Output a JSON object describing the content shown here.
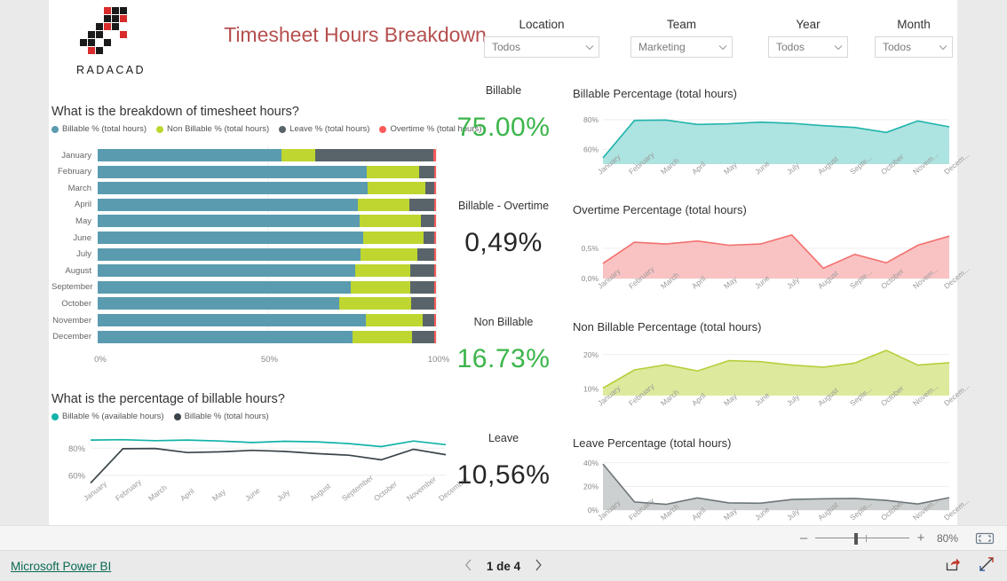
{
  "report": {
    "title": "Timesheet Hours Breakdown",
    "logo_text": "RADACAD"
  },
  "slicers": [
    {
      "name": "location",
      "label": "Location",
      "value": "Todos",
      "icon": "chevron-down-icon"
    },
    {
      "name": "team",
      "label": "Team",
      "value": "Marketing",
      "icon": "chevron-down-icon"
    },
    {
      "name": "year",
      "label": "Year",
      "value": "Todos",
      "icon": "chevron-down-icon"
    },
    {
      "name": "month",
      "label": "Month",
      "value": "Todos",
      "icon": "chevron-down-icon"
    }
  ],
  "kpis": [
    {
      "name": "billable",
      "label": "Billable",
      "value": "75.00%",
      "color": "#3bb54a"
    },
    {
      "name": "billable-overtime",
      "label": "Billable - Overtime",
      "value": "0,49%",
      "color": "#262626"
    },
    {
      "name": "non-billable",
      "label": "Non Billable",
      "value": "16.73%",
      "color": "#3bb54a"
    },
    {
      "name": "leave",
      "label": "Leave",
      "value": "10,56%",
      "color": "#262626"
    }
  ],
  "colors": {
    "billable": "#5a9bb0",
    "non_billable": "#bed62f",
    "leave": "#58646a",
    "overtime": "#fb5b5b",
    "billable_available_line": "#12b3a8",
    "billable_total_line": "#3a4449",
    "area_billable_fill": "#9fdedb",
    "area_billable_line": "#1fb3ab",
    "area_overtime_fill": "#f9b8b8",
    "area_overtime_line": "#f2706f",
    "area_nonbillable_fill": "#d7e68c",
    "area_nonbillable_line": "#b5cf3c",
    "area_leave_fill": "#c4c8c8",
    "area_leave_line": "#6d7579",
    "title_red": "#b5504f",
    "link_green": "#0b6a53"
  },
  "chart_data": [
    {
      "name": "timesheet-breakdown",
      "type": "bar",
      "orientation": "horizontal",
      "stacked": true,
      "percent": true,
      "title": "What is the breakdown of timesheet hours?",
      "xlabel": "",
      "ylabel": "",
      "xlim": [
        0,
        100
      ],
      "xticks": [
        "0%",
        "50%",
        "100%"
      ],
      "grid": true,
      "legend_position": "top",
      "categories": [
        "January",
        "February",
        "March",
        "April",
        "May",
        "June",
        "July",
        "August",
        "September",
        "October",
        "November",
        "December"
      ],
      "series": [
        {
          "name": "Billable % (total hours)",
          "color": "#5a9bb0",
          "values": [
            54.2,
            79.6,
            79.8,
            76.8,
            77.3,
            78.4,
            77.6,
            76.0,
            74.8,
            71.4,
            79.2,
            75.2
          ]
        },
        {
          "name": "Non Billable % (total hours)",
          "color": "#bed62f",
          "values": [
            10.2,
            15.5,
            17.0,
            15.2,
            18.2,
            17.9,
            16.9,
            16.3,
            17.5,
            21.2,
            16.9,
            17.6
          ]
        },
        {
          "name": "Leave % (total hours)",
          "color": "#58646a",
          "values": [
            34.9,
            4.3,
            2.6,
            7.4,
            3.9,
            3.1,
            4.9,
            7.2,
            7.2,
            7.0,
            3.4,
            6.7
          ]
        },
        {
          "name": "Overtime % (total hours)",
          "color": "#fb5b5b",
          "values": [
            0.7,
            0.6,
            0.6,
            0.6,
            0.6,
            0.6,
            0.6,
            0.5,
            0.5,
            0.4,
            0.5,
            0.5
          ]
        }
      ]
    },
    {
      "name": "billable-hours-percentage",
      "type": "line",
      "title": "What is the percentage of billable hours?",
      "xlabel": "",
      "ylabel": "",
      "ylim": [
        50,
        92
      ],
      "yticks": [
        "60%",
        "80%"
      ],
      "ytick_values": [
        60,
        80
      ],
      "grid": true,
      "legend_position": "top",
      "categories": [
        "January",
        "February",
        "March",
        "April",
        "May",
        "June",
        "July",
        "August",
        "September",
        "October",
        "November",
        "December"
      ],
      "series": [
        {
          "name": "Billable % (available hours)",
          "color": "#12b3a8",
          "values": [
            86.0,
            86.3,
            85.6,
            86.0,
            85.3,
            84.2,
            85.1,
            84.7,
            83.4,
            81.2,
            85.3,
            82.6
          ]
        },
        {
          "name": "Billable % (total hours)",
          "color": "#3a4449",
          "values": [
            54.2,
            79.6,
            79.8,
            76.8,
            77.3,
            78.4,
            77.6,
            76.0,
            74.8,
            71.4,
            79.2,
            75.2
          ]
        }
      ]
    },
    {
      "name": "billable-percentage-area",
      "type": "area",
      "title": "Billable Percentage (total hours)",
      "xlabel": "",
      "ylabel": "",
      "ylim": [
        50,
        86
      ],
      "yticks": [
        "60%",
        "80%"
      ],
      "ytick_values": [
        60,
        80
      ],
      "grid": true,
      "categories": [
        "January",
        "February",
        "March",
        "April",
        "May",
        "June",
        "July",
        "August",
        "Septe...",
        "October",
        "Novem...",
        "Decem..."
      ],
      "values": [
        54.2,
        79.6,
        79.8,
        76.8,
        77.3,
        78.4,
        77.6,
        76.0,
        74.8,
        71.4,
        79.2,
        75.2
      ]
    },
    {
      "name": "overtime-percentage-area",
      "type": "area",
      "title": "Overtime Percentage (total hours)",
      "xlabel": "",
      "ylabel": "",
      "ylim": [
        0,
        0.85
      ],
      "yticks": [
        "0,5%",
        "0,0%"
      ],
      "ytick_values": [
        0.5,
        0.0
      ],
      "grid": true,
      "categories": [
        "January",
        "February",
        "March",
        "April",
        "May",
        "June",
        "July",
        "August",
        "Septe...",
        "October",
        "Novem...",
        "Decem..."
      ],
      "values": [
        0.25,
        0.6,
        0.57,
        0.62,
        0.55,
        0.57,
        0.72,
        0.17,
        0.4,
        0.26,
        0.55,
        0.7
      ]
    },
    {
      "name": "non-billable-percentage-area",
      "type": "area",
      "title": "Non Billable Percentage (total hours)",
      "xlabel": "",
      "ylabel": "",
      "ylim": [
        8,
        23
      ],
      "yticks": [
        "20%",
        "10%"
      ],
      "ytick_values": [
        20,
        10
      ],
      "grid": true,
      "categories": [
        "January",
        "February",
        "March",
        "April",
        "May",
        "June",
        "July",
        "August",
        "Septe...",
        "October",
        "Novem...",
        "Decem..."
      ],
      "values": [
        10.2,
        15.5,
        17.0,
        15.2,
        18.2,
        17.9,
        16.9,
        16.3,
        17.5,
        21.2,
        16.9,
        17.6
      ]
    },
    {
      "name": "leave-percentage-area",
      "type": "area",
      "title": "Leave Percentage (total hours)",
      "xlabel": "",
      "ylabel": "",
      "ylim": [
        0,
        42
      ],
      "yticks": [
        "40%",
        "20%",
        "0%"
      ],
      "ytick_values": [
        40,
        20,
        0
      ],
      "grid": true,
      "categories": [
        "January",
        "February",
        "March",
        "April",
        "May",
        "June",
        "July",
        "August",
        "Septe...",
        "October",
        "Novem...",
        "Decem..."
      ],
      "values": [
        38.9,
        6.8,
        4.8,
        10.3,
        6.1,
        5.8,
        8.9,
        9.5,
        9.8,
        8.2,
        5.1,
        10.5
      ]
    }
  ],
  "zoombar": {
    "minus": "–",
    "plus": "+",
    "percent": "80%",
    "fit_icon": "fit-to-page-icon"
  },
  "statusbar": {
    "link": "Microsoft Power BI",
    "prev_icon": "chevron-left-icon",
    "next_icon": "chevron-right-icon",
    "page_label": "1 de 4",
    "share_icon": "share-icon",
    "fullscreen_icon": "fullscreen-icon"
  }
}
